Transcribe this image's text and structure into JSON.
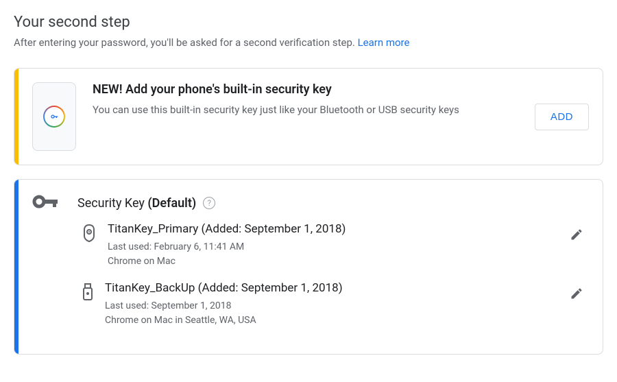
{
  "header": {
    "title": "Your second step",
    "subtitle_prefix": "After entering your password, you'll be asked for a second verification step. ",
    "learn_more": "Learn more"
  },
  "promo_card": {
    "title": "NEW! Add your phone's built-in security key",
    "desc": "You can use this built-in security key just like your Bluetooth or USB security keys",
    "add_button": "ADD"
  },
  "security_section": {
    "title_prefix": "Security Key ",
    "title_default": "(Default)",
    "keys": [
      {
        "name": "TitanKey_Primary (Added: September 1, 2018)",
        "last_used": "Last used: February 6, 11:41 AM",
        "context": "Chrome on Mac",
        "icon": "fob"
      },
      {
        "name": "TitanKey_BackUp (Added: September 1, 2018)",
        "last_used": "Last used: September 1, 2018",
        "context": "Chrome on Mac in Seattle, WA, USA",
        "icon": "usb"
      }
    ]
  }
}
